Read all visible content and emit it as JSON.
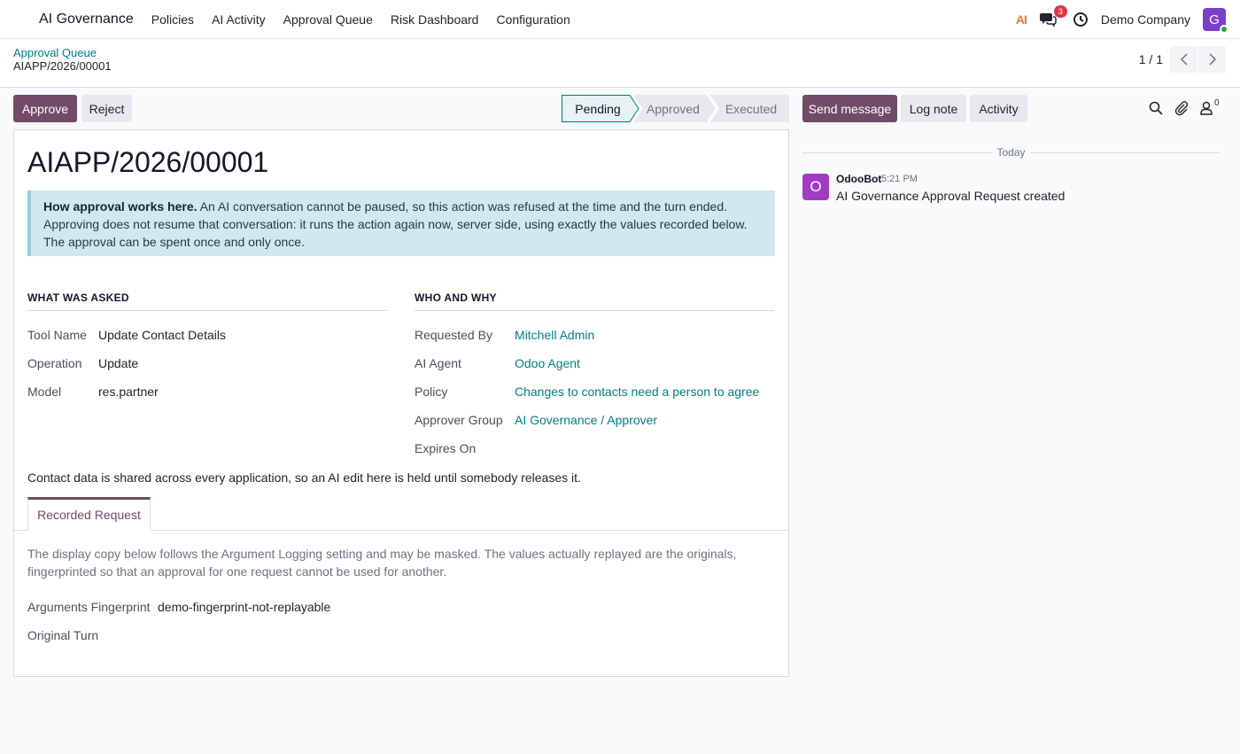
{
  "navbar": {
    "app_name": "AI Governance",
    "menu": [
      "Policies",
      "AI Activity",
      "Approval Queue",
      "Risk Dashboard",
      "Configuration"
    ],
    "ai_logo": "AI",
    "chat_count": "3",
    "company": "Demo Company",
    "user_initial": "G"
  },
  "breadcrumb": {
    "parent": "Approval Queue",
    "current": "AIAPP/2026/00001"
  },
  "pager": {
    "value": "1 / 1"
  },
  "actions": {
    "approve": "Approve",
    "reject": "Reject"
  },
  "statusbar": {
    "stages": [
      "Pending",
      "Approved",
      "Executed"
    ],
    "current": "Pending"
  },
  "form": {
    "title": "AIAPP/2026/00001",
    "alert_bold": "How approval works here.",
    "alert_text": " An AI conversation cannot be paused, so this action was refused at the time and the turn ended. Approving does not resume that conversation: it runs the action again now, server side, using exactly the values recorded below. The approval can be spent once and only once.",
    "left_section": {
      "heading": "WHAT WAS ASKED",
      "fields": [
        {
          "label": "Tool Name",
          "value": "Update Contact Details"
        },
        {
          "label": "Operation",
          "value": "Update"
        },
        {
          "label": "Model",
          "value": "res.partner"
        }
      ]
    },
    "right_section": {
      "heading": "WHO AND WHY",
      "fields": [
        {
          "label": "Requested By",
          "value": "Mitchell Admin"
        },
        {
          "label": "AI Agent",
          "value": "Odoo Agent"
        },
        {
          "label": "Policy",
          "value": "Changes to contacts need a person to agree"
        },
        {
          "label": "Approver Group",
          "value": "AI Governance / Approver"
        },
        {
          "label": "Expires On",
          "value": ""
        }
      ]
    },
    "note": "Contact data is shared across every application, so an AI edit here is held until somebody releases it.",
    "tab_label": "Recorded Request",
    "tab_help": "The display copy below follows the Argument Logging setting and may be masked. The values actually replayed are the originals, fingerprinted so that an approval for one request cannot be used for another.",
    "tab_fields": [
      {
        "label": "Arguments Fingerprint",
        "value": "demo-fingerprint-not-replayable"
      },
      {
        "label": "Original Turn",
        "value": ""
      }
    ]
  },
  "chatter": {
    "send_message": "Send message",
    "log_note": "Log note",
    "activity": "Activity",
    "followers_count": "0",
    "date_separator": "Today",
    "messages": [
      {
        "avatar": "O",
        "author": "OdooBot",
        "time": "5:21 PM",
        "body": "AI Governance Approval Request created"
      }
    ]
  },
  "colors": {
    "primary": "#714b67",
    "link": "#017e84",
    "alert_bg": "#cfe9ee"
  }
}
